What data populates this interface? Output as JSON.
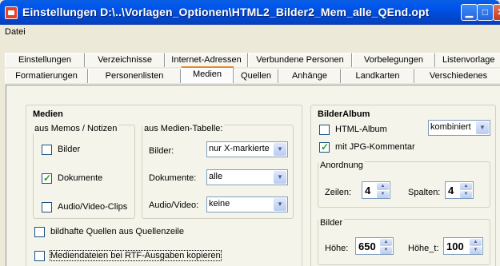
{
  "window": {
    "title": "Einstellungen  D:\\..\\Vorlagen_Optionen\\HTML2_Bilder2_Mem_alle_QEnd.opt"
  },
  "menubar": {
    "file": "Datei"
  },
  "tabs_row1": [
    "Einstellungen",
    "Verzeichnisse",
    "Internet-Adressen",
    "Verbundene Personen",
    "Vorbelegungen",
    "Listenvorlage"
  ],
  "tabs_row2": [
    "Formatierungen",
    "Personenlisten",
    "Medien",
    "Quellen",
    "Anhänge",
    "Landkarten",
    "Verschiedenes"
  ],
  "medien": {
    "title": "Medien",
    "memos_group": "aus Memos / Notizen",
    "bilder": "Bilder",
    "dokumente": "Dokumente",
    "audio_video": "Audio/Video-Clips",
    "tabelle_group": "aus Medien-Tabelle:",
    "t_bilder_label": "Bilder:",
    "t_bilder_value": "nur X-markierte",
    "t_dokumente_label": "Dokumente:",
    "t_dokumente_value": "alle",
    "t_audio_label": "Audio/Video:",
    "t_audio_value": "keine",
    "bildhafte": "bildhafte Quellen aus Quellenzeile",
    "mediendateien": "Mediendateien bei RTF-Ausgaben kopieren"
  },
  "bilderalbum": {
    "title": "BilderAlbum",
    "html_album": "HTML-Album",
    "mode_value": "kombiniert",
    "jpg_kommentar": "mit JPG-Kommentar",
    "anordnung_group": "Anordnung",
    "zeilen_label": "Zeilen:",
    "zeilen_value": "4",
    "spalten_label": "Spalten:",
    "spalten_value": "4",
    "bilder_group": "Bilder",
    "hoehe_label": "Höhe:",
    "hoehe_value": "650",
    "hoehe_t_label": "Höhe_t:",
    "hoehe_t_value": "100"
  },
  "checks": {
    "bilder": false,
    "dokumente": true,
    "audio_video": false,
    "bildhafte": false,
    "mediendateien": false,
    "html_album": false,
    "jpg_kommentar": true
  }
}
